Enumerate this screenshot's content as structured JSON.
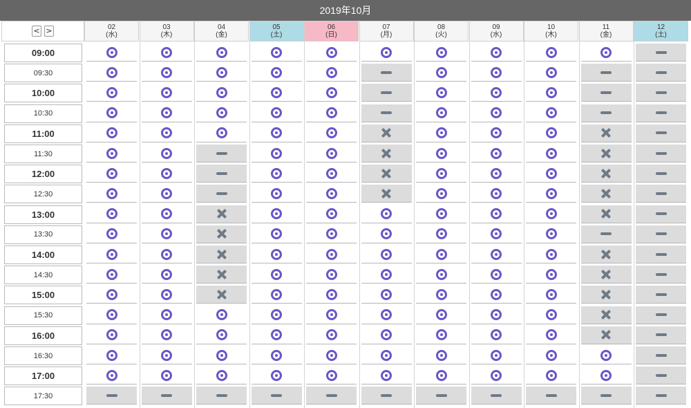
{
  "calendar": {
    "month_title": "2019年10月",
    "nav": {
      "prev": "<",
      "next": ">"
    }
  },
  "days": [
    {
      "date": "02",
      "weekday": "(水)",
      "type": "weekday"
    },
    {
      "date": "03",
      "weekday": "(木)",
      "type": "weekday"
    },
    {
      "date": "04",
      "weekday": "(金)",
      "type": "weekday"
    },
    {
      "date": "05",
      "weekday": "(土)",
      "type": "sat"
    },
    {
      "date": "06",
      "weekday": "(日)",
      "type": "sun"
    },
    {
      "date": "07",
      "weekday": "(月)",
      "type": "weekday"
    },
    {
      "date": "08",
      "weekday": "(火)",
      "type": "weekday"
    },
    {
      "date": "09",
      "weekday": "(水)",
      "type": "weekday"
    },
    {
      "date": "10",
      "weekday": "(木)",
      "type": "weekday"
    },
    {
      "date": "11",
      "weekday": "(金)",
      "type": "weekday"
    },
    {
      "date": "12",
      "weekday": "(土)",
      "type": "sat"
    }
  ],
  "times": [
    {
      "label": "09:00",
      "hour": true
    },
    {
      "label": "09:30",
      "hour": false
    },
    {
      "label": "10:00",
      "hour": true
    },
    {
      "label": "10:30",
      "hour": false
    },
    {
      "label": "11:00",
      "hour": true
    },
    {
      "label": "11:30",
      "hour": false
    },
    {
      "label": "12:00",
      "hour": true
    },
    {
      "label": "12:30",
      "hour": false
    },
    {
      "label": "13:00",
      "hour": true
    },
    {
      "label": "13:30",
      "hour": false
    },
    {
      "label": "14:00",
      "hour": true
    },
    {
      "label": "14:30",
      "hour": false
    },
    {
      "label": "15:00",
      "hour": true
    },
    {
      "label": "15:30",
      "hour": false
    },
    {
      "label": "16:00",
      "hour": true
    },
    {
      "label": "16:30",
      "hour": false
    },
    {
      "label": "17:00",
      "hour": true
    },
    {
      "label": "17:30",
      "hour": false
    }
  ],
  "status_legend": {
    "O": "available-circle-icon",
    "-": "closed-dash-icon",
    "X": "full-cross-icon"
  },
  "colors": {
    "available": "#6a55c6",
    "unavailable_icon": "#6e7a87",
    "unavailable_bg": "#dcdcdc",
    "saturday": "#aedbe6",
    "sunday": "#f7b9c6",
    "title_bar": "#666666"
  },
  "grid": [
    [
      "O",
      "O",
      "O",
      "O",
      "O",
      "O",
      "O",
      "O",
      "O",
      "O",
      "-"
    ],
    [
      "O",
      "O",
      "O",
      "O",
      "O",
      "-",
      "O",
      "O",
      "O",
      "-",
      "-"
    ],
    [
      "O",
      "O",
      "O",
      "O",
      "O",
      "-",
      "O",
      "O",
      "O",
      "-",
      "-"
    ],
    [
      "O",
      "O",
      "O",
      "O",
      "O",
      "-",
      "O",
      "O",
      "O",
      "-",
      "-"
    ],
    [
      "O",
      "O",
      "O",
      "O",
      "O",
      "X",
      "O",
      "O",
      "O",
      "X",
      "-"
    ],
    [
      "O",
      "O",
      "-",
      "O",
      "O",
      "X",
      "O",
      "O",
      "O",
      "X",
      "-"
    ],
    [
      "O",
      "O",
      "-",
      "O",
      "O",
      "X",
      "O",
      "O",
      "O",
      "X",
      "-"
    ],
    [
      "O",
      "O",
      "-",
      "O",
      "O",
      "X",
      "O",
      "O",
      "O",
      "X",
      "-"
    ],
    [
      "O",
      "O",
      "X",
      "O",
      "O",
      "O",
      "O",
      "O",
      "O",
      "X",
      "-"
    ],
    [
      "O",
      "O",
      "X",
      "O",
      "O",
      "O",
      "O",
      "O",
      "O",
      "-",
      "-"
    ],
    [
      "O",
      "O",
      "X",
      "O",
      "O",
      "O",
      "O",
      "O",
      "O",
      "X",
      "-"
    ],
    [
      "O",
      "O",
      "X",
      "O",
      "O",
      "O",
      "O",
      "O",
      "O",
      "X",
      "-"
    ],
    [
      "O",
      "O",
      "X",
      "O",
      "O",
      "O",
      "O",
      "O",
      "O",
      "X",
      "-"
    ],
    [
      "O",
      "O",
      "O",
      "O",
      "O",
      "O",
      "O",
      "O",
      "O",
      "X",
      "-"
    ],
    [
      "O",
      "O",
      "O",
      "O",
      "O",
      "O",
      "O",
      "O",
      "O",
      "X",
      "-"
    ],
    [
      "O",
      "O",
      "O",
      "O",
      "O",
      "O",
      "O",
      "O",
      "O",
      "O",
      "-"
    ],
    [
      "O",
      "O",
      "O",
      "O",
      "O",
      "O",
      "O",
      "O",
      "O",
      "O",
      "-"
    ],
    [
      "-",
      "-",
      "-",
      "-",
      "-",
      "-",
      "-",
      "-",
      "-",
      "-",
      "-"
    ]
  ]
}
